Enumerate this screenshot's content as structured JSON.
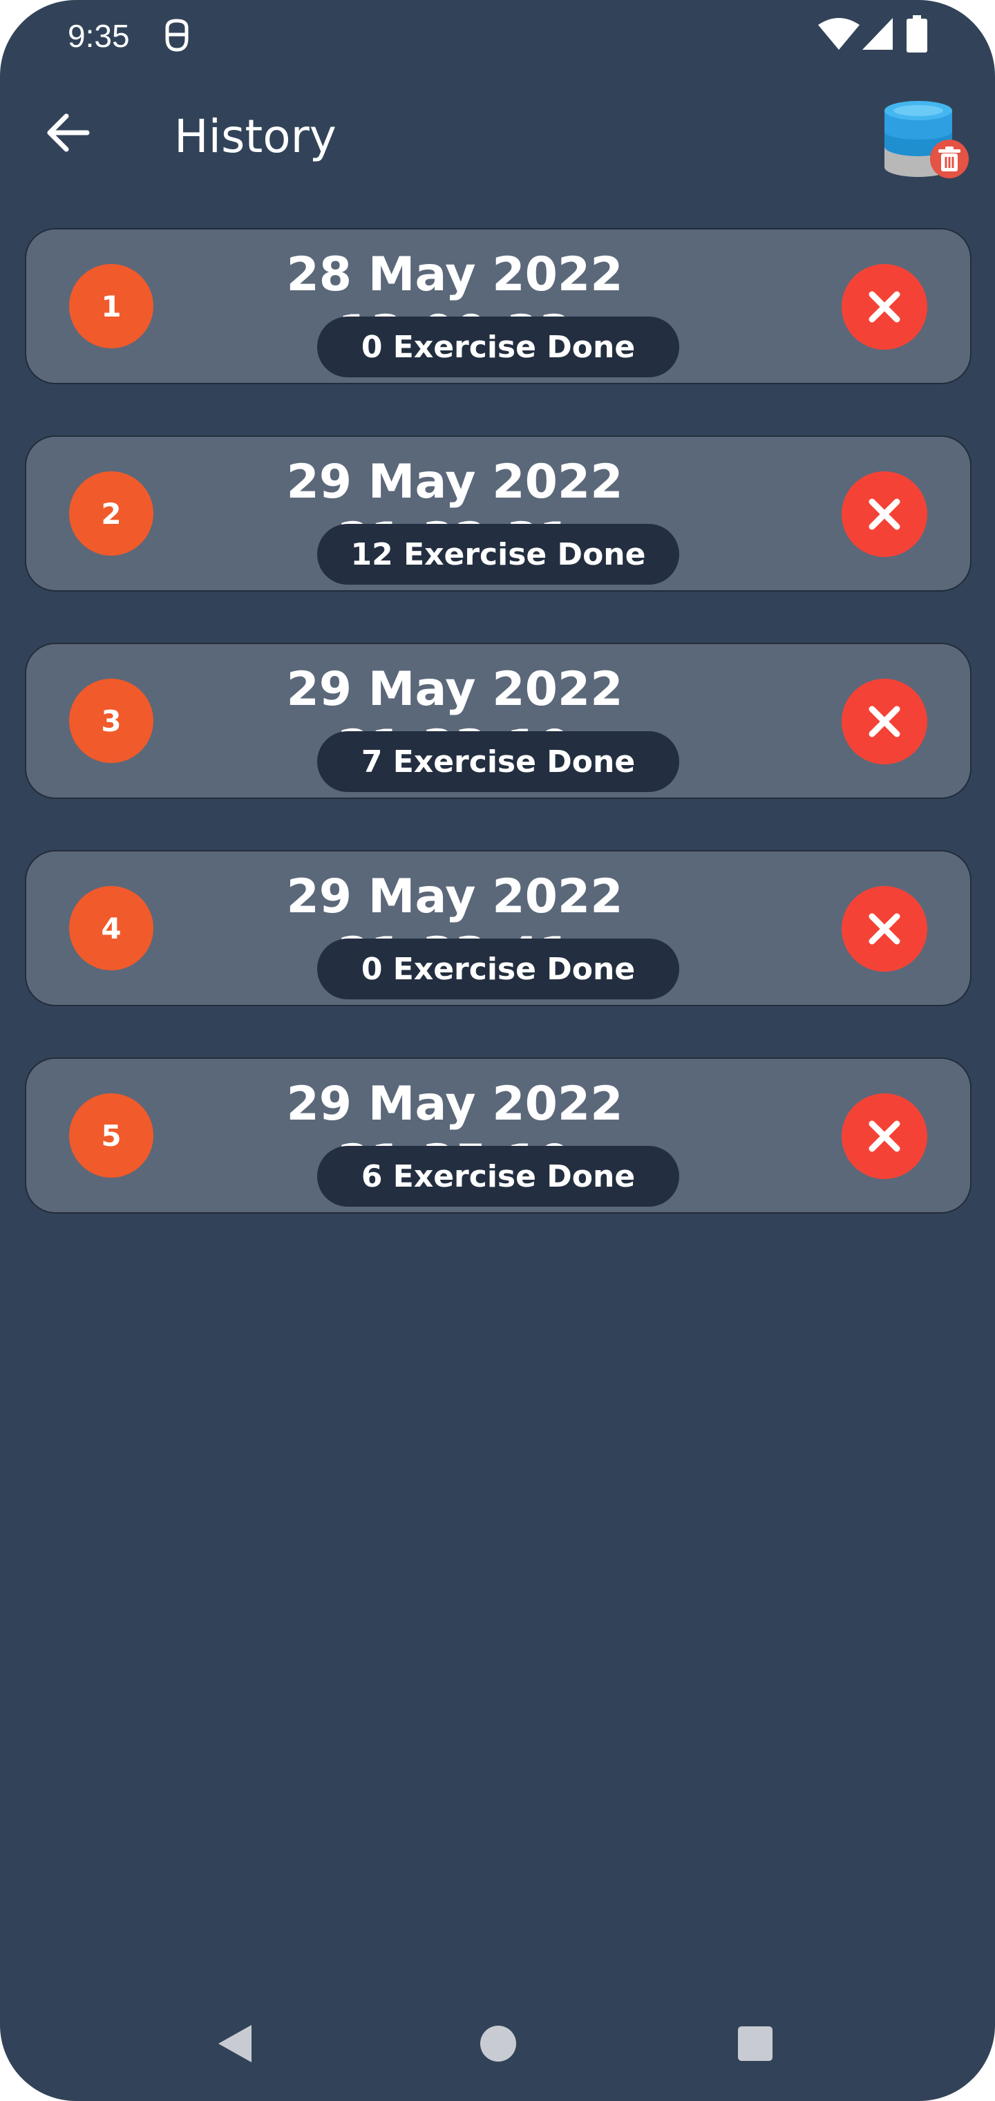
{
  "status_bar": {
    "time": "9:35",
    "icons": [
      "notification-icon",
      "wifi-icon",
      "signal-icon",
      "battery-icon"
    ]
  },
  "app_bar": {
    "title": "History",
    "back_icon": "arrow-left-icon",
    "action_icon": "database-delete-icon"
  },
  "colors": {
    "background": "#324359",
    "card": "#5b687a",
    "pill": "#232f40",
    "badge": "#f15a2a",
    "delete": "#f44336"
  },
  "history": [
    {
      "number": "1",
      "date": "28 May 2022 13:00:33",
      "exercises": "0 Exercise Done"
    },
    {
      "number": "2",
      "date": "29 May 2022 21:32:31",
      "exercises": "12 Exercise Done"
    },
    {
      "number": "3",
      "date": "29 May 2022 21:33:19",
      "exercises": "7 Exercise Done"
    },
    {
      "number": "4",
      "date": "29 May 2022 21:33:41",
      "exercises": "0 Exercise Done"
    },
    {
      "number": "5",
      "date": "29 May 2022 21:35:19",
      "exercises": "6 Exercise Done"
    }
  ],
  "nav_bar": {
    "icons": [
      "back-triangle-icon",
      "home-circle-icon",
      "recents-square-icon"
    ]
  }
}
